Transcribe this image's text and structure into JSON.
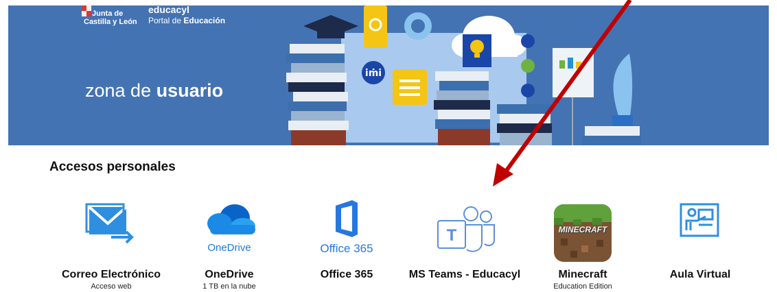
{
  "header": {
    "org_line1": "Junta de",
    "org_line2": "Castilla y León",
    "brand_name": "educacyl",
    "brand_sub_prefix": "Portal de",
    "brand_sub_bold": "Educación",
    "zona_prefix": "zona de",
    "zona_bold": "usuario",
    "banner_color": "#4473b3"
  },
  "section": {
    "title": "Accesos personales"
  },
  "tiles": [
    {
      "name": "Correo Electrónico",
      "sub": "Acceso web",
      "icon": "mail-icon"
    },
    {
      "name": "OneDrive",
      "sub": "1 TB en la nube",
      "icon": "onedrive-icon",
      "icon_label": "OneDrive"
    },
    {
      "name": "Office 365",
      "sub": "",
      "icon": "office365-icon",
      "icon_label": "Office 365"
    },
    {
      "name": "MS Teams - Educacyl",
      "sub": "",
      "icon": "teams-icon"
    },
    {
      "name": "Minecraft",
      "sub": "Education Edition",
      "icon": "minecraft-icon",
      "icon_label": "MINECRAFT"
    },
    {
      "name": "Aula Virtual",
      "sub": "",
      "icon": "aula-virtual-icon"
    }
  ],
  "annotation": {
    "arrow_color": "#c00000"
  }
}
